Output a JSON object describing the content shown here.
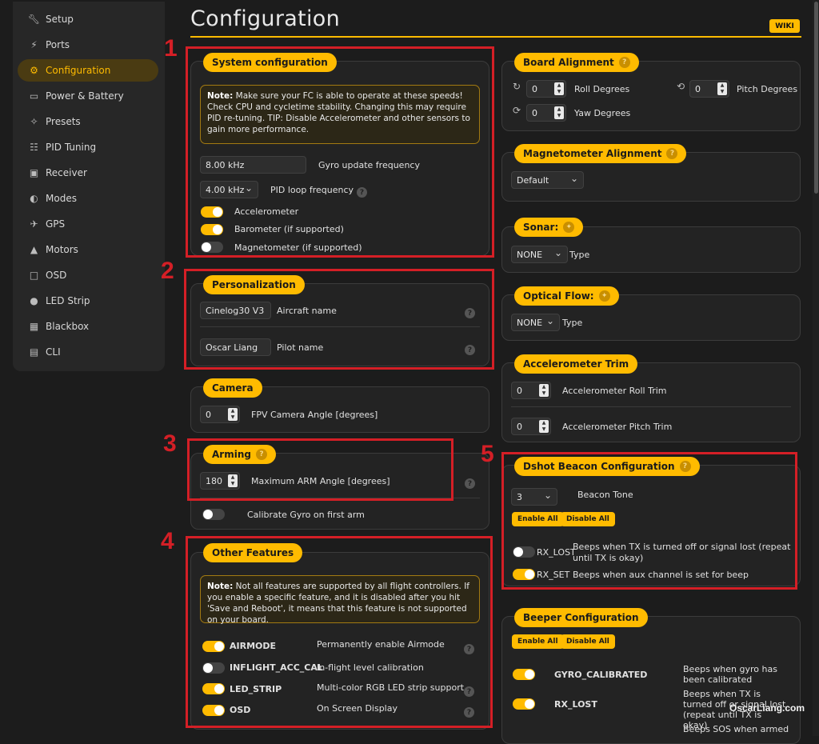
{
  "sidebar": {
    "items": [
      {
        "label": "Setup",
        "icon": "wrench-icon"
      },
      {
        "label": "Ports",
        "icon": "plug-icon"
      },
      {
        "label": "Configuration",
        "icon": "gear-icon",
        "active": true
      },
      {
        "label": "Power & Battery",
        "icon": "battery-icon"
      },
      {
        "label": "Presets",
        "icon": "magic-icon"
      },
      {
        "label": "PID Tuning",
        "icon": "sliders-icon"
      },
      {
        "label": "Receiver",
        "icon": "radio-icon"
      },
      {
        "label": "Modes",
        "icon": "switch-icon"
      },
      {
        "label": "GPS",
        "icon": "satellite-icon"
      },
      {
        "label": "Motors",
        "icon": "motor-icon"
      },
      {
        "label": "OSD",
        "icon": "screen-icon"
      },
      {
        "label": "LED Strip",
        "icon": "bulb-icon"
      },
      {
        "label": "Blackbox",
        "icon": "blackbox-icon"
      },
      {
        "label": "CLI",
        "icon": "terminal-icon"
      }
    ]
  },
  "header": {
    "title": "Configuration",
    "wiki": "WIKI"
  },
  "system": {
    "title": "System configuration",
    "note_bold": "Note:",
    "note": " Make sure your FC is able to operate at these speeds! Check CPU and cycletime stability. Changing this may require PID re-tuning. TIP: Disable Accelerometer and other sensors to gain more performance.",
    "gyro_value": "8.00 kHz",
    "gyro_label": "Gyro update frequency",
    "pid_value": "4.00 kHz",
    "pid_label": "PID loop frequency",
    "accel_label": "Accelerometer",
    "baro_label": "Barometer (if supported)",
    "mag_label": "Magnetometer (if supported)"
  },
  "personalization": {
    "title": "Personalization",
    "craft_value": "Cinelog30 V3",
    "craft_label": "Aircraft name",
    "pilot_value": "Oscar Liang",
    "pilot_label": "Pilot name"
  },
  "camera": {
    "title": "Camera",
    "angle_value": "0",
    "angle_label": "FPV Camera Angle [degrees]"
  },
  "arming": {
    "title": "Arming",
    "angle_value": "180",
    "angle_label": "Maximum ARM Angle [degrees]",
    "calib_label": "Calibrate Gyro on first arm"
  },
  "features": {
    "title": "Other Features",
    "note_bold": "Note:",
    "note": " Not all features are supported by all flight controllers. If you enable a specific feature, and it is disabled after you hit 'Save and Reboot', it means that this feature is not supported on your board.",
    "items": [
      {
        "name": "AIRMODE",
        "desc": "Permanently enable Airmode"
      },
      {
        "name": "INFLIGHT_ACC_CAL",
        "desc": "In-flight level calibration"
      },
      {
        "name": "LED_STRIP",
        "desc": "Multi-color RGB LED strip support"
      },
      {
        "name": "OSD",
        "desc": "On Screen Display"
      }
    ]
  },
  "board": {
    "title": "Board Alignment",
    "roll_value": "0",
    "roll_label": "Roll Degrees",
    "pitch_value": "0",
    "pitch_label": "Pitch Degrees",
    "yaw_value": "0",
    "yaw_label": "Yaw Degrees"
  },
  "mag": {
    "title": "Magnetometer Alignment",
    "value": "Default"
  },
  "sonar": {
    "title": "Sonar:",
    "value": "NONE",
    "label": "Type"
  },
  "optical": {
    "title": "Optical Flow:",
    "value": "NONE",
    "label": "Type"
  },
  "acctrim": {
    "title": "Accelerometer Trim",
    "roll_value": "0",
    "roll_label": "Accelerometer Roll Trim",
    "pitch_value": "0",
    "pitch_label": "Accelerometer Pitch Trim"
  },
  "dshot": {
    "title": "Dshot Beacon Configuration",
    "tone_value": "3",
    "tone_label": "Beacon Tone",
    "enable_all": "Enable All",
    "disable_all": "Disable All",
    "rx_lost_name": "RX_LOST",
    "rx_lost_desc": "Beeps when TX is turned off or signal lost (repeat until TX is okay)",
    "rx_set_name": "RX_SET",
    "rx_set_desc": "Beeps when aux channel is set for beep"
  },
  "beeper": {
    "title": "Beeper Configuration",
    "enable_all": "Enable All",
    "disable_all": "Disable All",
    "gyro_name": "GYRO_CALIBRATED",
    "gyro_desc": "Beeps when gyro has been calibrated",
    "rx_name": "RX_LOST",
    "rx_desc": "Beeps when TX is turned off or signal lost (repeat until TX is okay)",
    "sos_desc": "Beeps SOS when armed"
  },
  "annotations": [
    "1",
    "2",
    "3",
    "4",
    "5"
  ],
  "watermark": "OscarLiang.com",
  "colors": {
    "accent": "#ffbb00",
    "annotation": "#d41f26",
    "background": "#1c1c1c"
  }
}
